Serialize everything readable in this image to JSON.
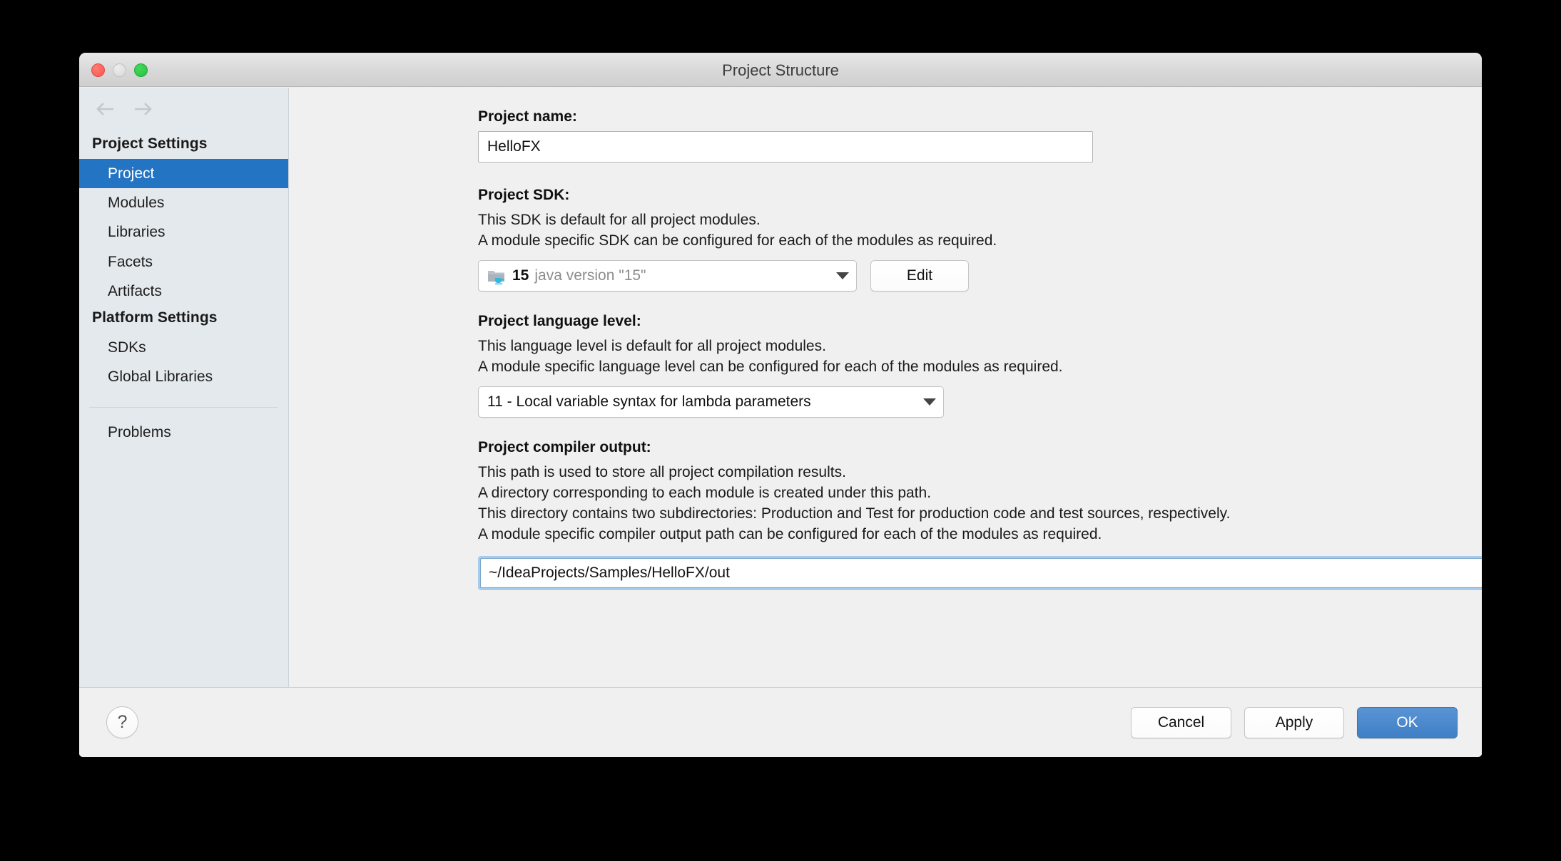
{
  "window": {
    "title": "Project Structure",
    "traffic_lights": [
      "close-button",
      "minimize-button",
      "zoom-button"
    ]
  },
  "sidebar": {
    "back_icon": "arrow-left-icon",
    "forward_icon": "arrow-right-icon",
    "groups": [
      {
        "title": "Project Settings",
        "items": [
          {
            "label": "Project",
            "selected": true
          },
          {
            "label": "Modules",
            "selected": false
          },
          {
            "label": "Libraries",
            "selected": false
          },
          {
            "label": "Facets",
            "selected": false
          },
          {
            "label": "Artifacts",
            "selected": false
          }
        ]
      },
      {
        "title": "Platform Settings",
        "items": [
          {
            "label": "SDKs",
            "selected": false
          },
          {
            "label": "Global Libraries",
            "selected": false
          }
        ]
      }
    ],
    "extra_item": {
      "label": "Problems",
      "selected": false
    }
  },
  "main": {
    "project_name": {
      "label": "Project name:",
      "value": "HelloFX"
    },
    "project_sdk": {
      "label": "Project SDK:",
      "desc_line1": "This SDK is default for all project modules.",
      "desc_line2": "A module specific SDK can be configured for each of the modules as required.",
      "selected_number": "15",
      "selected_version": "java version \"15\"",
      "icon": "jdk-folder-icon",
      "caret": "chevron-down-icon",
      "edit_label": "Edit"
    },
    "language_level": {
      "label": "Project language level:",
      "desc_line1": "This language level is default for all project modules.",
      "desc_line2": "A module specific language level can be configured for each of the modules as required.",
      "selected": "11 - Local variable syntax for lambda parameters",
      "caret": "chevron-down-icon"
    },
    "compiler_output": {
      "label": "Project compiler output:",
      "desc_line1": "This path is used to store all project compilation results.",
      "desc_line2": "A directory corresponding to each module is created under this path.",
      "desc_line3": "This directory contains two subdirectories: Production and Test for production code and test sources, respectively.",
      "desc_line4": "A module specific compiler output path can be configured for each of the modules as required.",
      "path_value": "~/IdeaProjects/Samples/HelloFX/out",
      "browse_icon": "folder-browse-icon"
    }
  },
  "footer": {
    "help_label": "?",
    "cancel_label": "Cancel",
    "apply_label": "Apply",
    "ok_label": "OK"
  },
  "colors": {
    "selection_blue": "#2474c4",
    "ok_button_blue": "#4786cc",
    "sidebar_bg": "#e4e9ed",
    "panel_bg": "#f0f0f0",
    "focus_ring": "#a7cbeb"
  }
}
